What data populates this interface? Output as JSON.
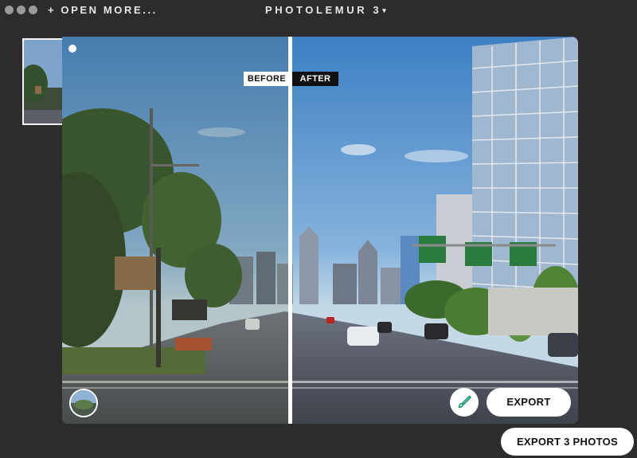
{
  "titlebar": {
    "open_more": "+ OPEN MORE...",
    "app_title": "PHOTOLEMUR 3",
    "title_caret": "▾"
  },
  "thumbnail": {
    "selected": true
  },
  "compare": {
    "before_label": "BEFORE",
    "after_label": "AFTER"
  },
  "toolbar": {
    "export_label": "EXPORT",
    "brush_icon": "brush-icon"
  },
  "footer": {
    "export_all_label": "EXPORT 3 PHOTOS"
  }
}
